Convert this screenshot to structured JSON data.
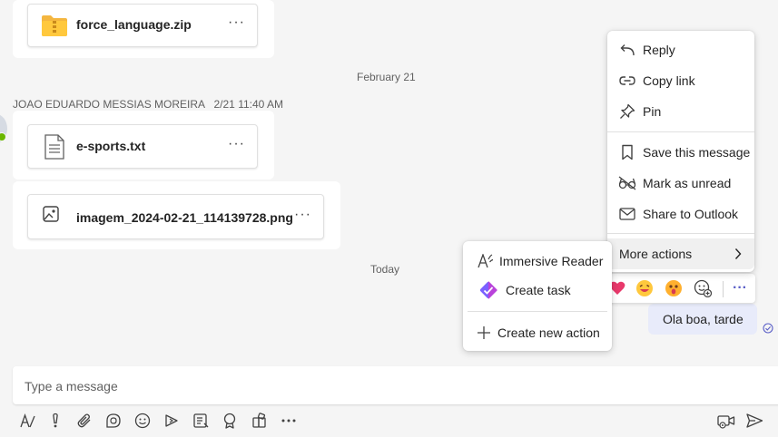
{
  "attachments": {
    "zip": {
      "name": "force_language.zip",
      "more": "···"
    },
    "txt": {
      "name": "e-sports.txt",
      "more": "···"
    },
    "img": {
      "name": "imagem_2024-02-21_114139728.png",
      "more": "···"
    }
  },
  "date_separators": {
    "feb21": "February 21",
    "today": "Today"
  },
  "message_header": {
    "sender": "JOAO EDUARDO MESSIAS MOREIRA",
    "time": "2/21 11:40 AM"
  },
  "own_message": {
    "text": "Ola boa, tarde"
  },
  "context_menu": {
    "reply": "Reply",
    "copy_link": "Copy link",
    "pin": "Pin",
    "save": "Save this message",
    "mark_unread": "Mark as unread",
    "share_outlook": "Share to Outlook",
    "more_actions": "More actions"
  },
  "submenu": {
    "immersive_reader": "Immersive Reader",
    "create_task": "Create task",
    "create_new_action": "Create new action"
  },
  "reaction_bar": {
    "more": "···"
  },
  "compose": {
    "placeholder": "Type a message"
  },
  "colors": {
    "accent": "#5b5fc7",
    "own_bubble": "#e8ebfa",
    "zip_folder": "#f4b63f"
  }
}
